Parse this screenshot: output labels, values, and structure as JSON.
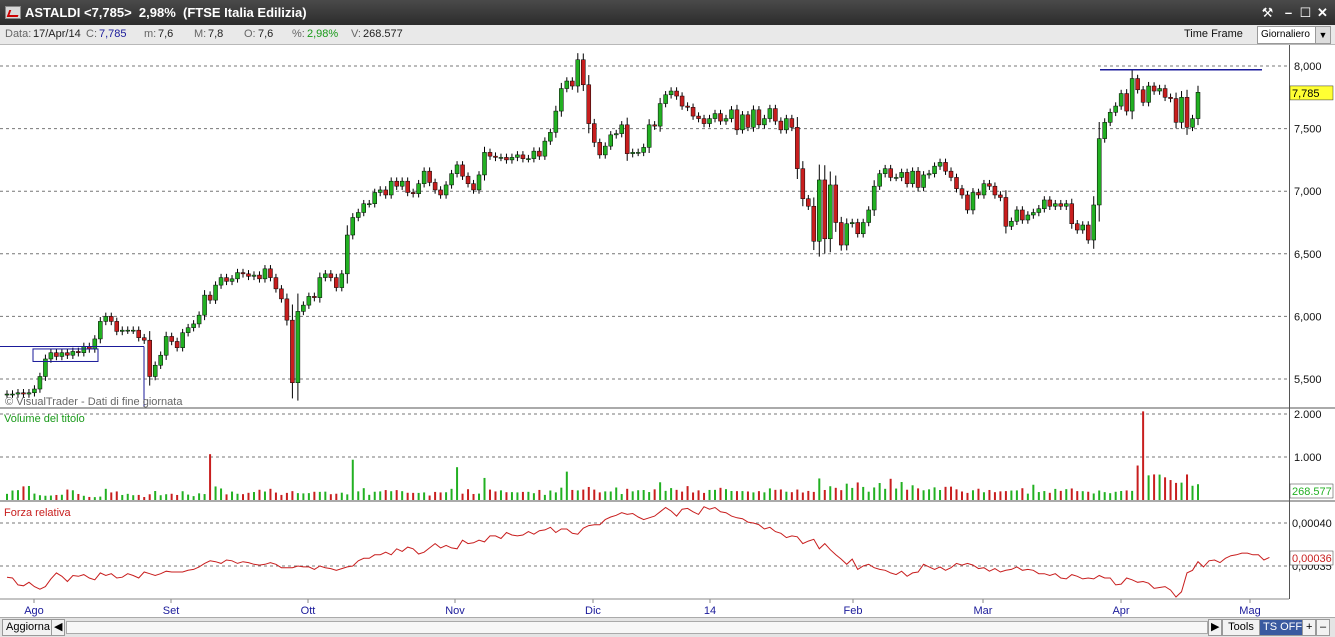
{
  "window": {
    "title": "ASTALDI <7,785>  2,98%  (FTSE Italia Edilizia)"
  },
  "info": {
    "data_label": "Data:",
    "data_value": "17/Apr/14",
    "c_label": "C:",
    "c_value": "7,785",
    "m_label": "m:",
    "m_value": "7,6",
    "M_label": "M:",
    "M_value": "7,8",
    "O_label": "O:",
    "O_value": "7,6",
    "pct_label": "%:",
    "pct_value": "2,98%",
    "v_label": "V:",
    "v_value": "268.577",
    "time_frame_label": "Time Frame",
    "time_frame_value": "Giornaliero"
  },
  "bottom": {
    "refresh": "Aggiorna",
    "tools": "Tools",
    "ts": "TS OFF"
  },
  "colors": {
    "up": "#22b022",
    "down": "#c81e1e",
    "rs": "#c81e1e",
    "axis_label": "#1a1a9a"
  },
  "chart": {
    "watermark": "© VisualTrader - Dati di fine giornata",
    "volume_title": "Volume del titolo",
    "rs_title": "Forza relativa"
  },
  "chart_data": {
    "type": "candlestick",
    "x_labels": [
      "Ago",
      "Set",
      "Ott",
      "Nov",
      "Dic",
      "14",
      "Feb",
      "Mar",
      "Apr",
      "Mag"
    ],
    "price_ticks": [
      "8,000",
      "7,500",
      "7,000",
      "6,500",
      "6,000",
      "5,500"
    ],
    "volume_ticks": [
      "2.000",
      "1.000"
    ],
    "rs_ticks": [
      "0,00040",
      "0,00035"
    ],
    "last_price_label": "7,785",
    "last_volume_label": "268.577",
    "last_rs_label": "0,00036",
    "price_ylim": [
      5.25,
      8.1
    ],
    "volume_ylim": [
      0,
      2000
    ],
    "rs_ylim": [
      0.00031,
      0.00042
    ],
    "resistance_level": 7.97,
    "closes": [
      5.38,
      5.38,
      5.39,
      5.38,
      5.39,
      5.42,
      5.52,
      5.66,
      5.71,
      5.68,
      5.71,
      5.69,
      5.72,
      5.71,
      5.76,
      5.74,
      5.82,
      5.96,
      6,
      5.96,
      5.88,
      5.89,
      5.89,
      5.89,
      5.83,
      5.81,
      5.52,
      5.61,
      5.69,
      5.84,
      5.8,
      5.75,
      5.87,
      5.91,
      5.94,
      6.01,
      6.17,
      6.13,
      6.25,
      6.31,
      6.28,
      6.3,
      6.35,
      6.34,
      6.32,
      6.33,
      6.3,
      6.38,
      6.31,
      6.22,
      6.14,
      5.97,
      5.47,
      6.04,
      6.09,
      6.16,
      6.15,
      6.31,
      6.34,
      6.31,
      6.23,
      6.34,
      6.65,
      6.79,
      6.83,
      6.9,
      6.9,
      6.99,
      7.01,
      6.97,
      7.08,
      7.04,
      7.08,
      6.99,
      6.98,
      7.06,
      7.16,
      7.07,
      7.01,
      6.97,
      7.05,
      7.14,
      7.21,
      7.12,
      7.06,
      7.01,
      7.13,
      7.31,
      7.28,
      7.27,
      7.27,
      7.25,
      7.27,
      7.29,
      7.26,
      7.26,
      7.32,
      7.28,
      7.4,
      7.47,
      7.64,
      7.82,
      7.88,
      7.84,
      8.05,
      7.85,
      7.54,
      7.39,
      7.29,
      7.36,
      7.45,
      7.46,
      7.53,
      7.3,
      7.31,
      7.31,
      7.35,
      7.53,
      7.52,
      7.7,
      7.77,
      7.8,
      7.76,
      7.68,
      7.67,
      7.6,
      7.58,
      7.54,
      7.58,
      7.62,
      7.56,
      7.58,
      7.65,
      7.49,
      7.61,
      7.51,
      7.65,
      7.53,
      7.58,
      7.66,
      7.56,
      7.49,
      7.58,
      7.51,
      7.18,
      6.94,
      6.88,
      6.6,
      7.09,
      6.62,
      7.05,
      6.75,
      6.57,
      6.74,
      6.75,
      6.66,
      6.75,
      6.85,
      7.04,
      7.14,
      7.18,
      7.11,
      7.11,
      7.15,
      7.06,
      7.16,
      7.03,
      7.13,
      7.14,
      7.2,
      7.23,
      7.16,
      7.11,
      7.02,
      6.97,
      6.85,
      6.99,
      6.97,
      7.06,
      7.04,
      6.97,
      6.95,
      6.72,
      6.76,
      6.85,
      6.77,
      6.81,
      6.83,
      6.86,
      6.93,
      6.88,
      6.9,
      6.88,
      6.9,
      6.74,
      6.69,
      6.73,
      6.61,
      6.89,
      7.42,
      7.55,
      7.63,
      7.68,
      7.78,
      7.64,
      7.9,
      7.81,
      7.71,
      7.84,
      7.8,
      7.82,
      7.75,
      7.74,
      7.55,
      7.75,
      7.51,
      7.58,
      7.79
    ],
    "volumes": [
      143,
      221,
      229,
      317,
      326,
      149,
      111,
      99,
      104,
      117,
      122,
      243,
      226,
      140,
      98,
      71,
      67,
      79,
      260,
      176,
      199,
      117,
      143,
      112,
      118,
      69,
      133,
      209,
      111,
      134,
      145,
      117,
      204,
      126,
      90,
      155,
      138,
      1066,
      315,
      268,
      131,
      196,
      145,
      136,
      167,
      185,
      238,
      197,
      260,
      173,
      118,
      165,
      206,
      160,
      154,
      160,
      191,
      189,
      194,
      135,
      146,
      170,
      131,
      937,
      201,
      275,
      120,
      192,
      200,
      231,
      204,
      230,
      205,
      168,
      166,
      165,
      176,
      104,
      188,
      176,
      180,
      260,
      763,
      147,
      251,
      140,
      149,
      513,
      242,
      199,
      224,
      181,
      183,
      177,
      188,
      190,
      158,
      234,
      119,
      221,
      177,
      287,
      660,
      234,
      223,
      242,
      303,
      242,
      177,
      200,
      198,
      291,
      139,
      260,
      201,
      227,
      232,
      185,
      248,
      412,
      213,
      277,
      236,
      195,
      323,
      175,
      224,
      165,
      234,
      236,
      283,
      252,
      209,
      206,
      207,
      198,
      177,
      206,
      178,
      270,
      236,
      245,
      193,
      182,
      243,
      174,
      211,
      188,
      501,
      233,
      320,
      283,
      229,
      380,
      281,
      408,
      304,
      193,
      292,
      395,
      260,
      493,
      266,
      418,
      239,
      342,
      270,
      226,
      248,
      294,
      232,
      306,
      311,
      248,
      198,
      165,
      226,
      262,
      180,
      233,
      182,
      201,
      207,
      220,
      223,
      274,
      148,
      355,
      185,
      208,
      167,
      258,
      212,
      252,
      268,
      207,
      205,
      192,
      152,
      221,
      183,
      159,
      191,
      209,
      222,
      212,
      802,
      2061,
      573,
      595,
      591,
      527,
      464,
      398,
      404,
      594,
      331,
      367,
      252,
      536,
      421,
      299,
      269
    ],
    "relative_strength": [
      0.000337,
      0.000336,
      0.000328,
      0.000327,
      0.000331,
      0.000326,
      0.000323,
      0.000326,
      0.000335,
      0.000342,
      0.000338,
      0.000332,
      0.000339,
      0.000338,
      0.00034,
      0.000336,
      0.000334,
      0.000342,
      0.000339,
      0.000341,
      0.000336,
      0.000337,
      0.000341,
      0.000339,
      0.000336,
      0.000343,
      0.000341,
      0.000339,
      0.000341,
      0.000344,
      0.000343,
      0.000343,
      0.000343,
      0.000345,
      0.000346,
      0.000349,
      0.000353,
      0.000356,
      0.000355,
      0.000353,
      0.000357,
      0.000356,
      0.000353,
      0.000355,
      0.000354,
      0.000352,
      0.000351,
      0.000352,
      0.000354,
      0.000352,
      0.000348,
      0.000348,
      0.000348,
      0.00035,
      0.000349,
      0.000349,
      0.000346,
      0.00035,
      0.000348,
      0.000347,
      0.000345,
      0.000347,
      0.000349,
      0.00035,
      0.000356,
      0.000359,
      0.000359,
      0.000363,
      0.000363,
      0.000366,
      0.000363,
      0.00037,
      0.000367,
      0.000372,
      0.00037,
      0.000364,
      0.000366,
      0.000371,
      0.000376,
      0.000371,
      0.000374,
      0.000371,
      0.00037,
      0.00038,
      0.000376,
      0.000377,
      0.00038,
      0.000378,
      0.000385,
      0.000385,
      0.000382,
      0.000389,
      0.000386,
      0.000385,
      0.000386,
      0.00039,
      0.000387,
      0.000391,
      0.000392,
      0.000395,
      0.000389,
      0.000393,
      0.000393,
      0.000388,
      0.000387,
      0.000394,
      0.000397,
      0.000398,
      0.000398,
      0.000404,
      0.000407,
      0.000409,
      0.000412,
      0.00041,
      0.000411,
      0.000407,
      0.000404,
      0.000406,
      0.000408,
      0.000413,
      0.000418,
      0.000414,
      0.000408,
      0.000416,
      0.000417,
      0.000413,
      0.00041,
      0.000419,
      0.000416,
      0.000418,
      0.000413,
      0.000412,
      0.000408,
      0.000406,
      0.000405,
      0.000401,
      0.0004,
      0.000398,
      0.000393,
      0.000395,
      0.00039,
      0.000388,
      0.000383,
      0.000385,
      0.000384,
      0.000376,
      0.000379,
      0.000381,
      0.00037,
      0.000376,
      0.000369,
      0.000363,
      0.000358,
      0.000352,
      0.000358,
      0.000346,
      0.00035,
      0.000352,
      0.000348,
      0.000346,
      0.000345,
      0.000342,
      0.00034,
      0.000344,
      0.000338,
      0.000342,
      0.000343,
      0.000352,
      0.000349,
      0.000346,
      0.000349,
      0.000345,
      0.000348,
      0.000353,
      0.000351,
      0.000353,
      0.000351,
      0.000347,
      0.000348,
      0.000344,
      0.000347,
      0.000343,
      0.000345,
      0.000346,
      0.000349,
      0.000345,
      0.000346,
      0.000345,
      0.000341,
      0.000341,
      0.000339,
      0.000341,
      0.000336,
      0.000335,
      0.00034,
      0.000338,
      0.000335,
      0.000336,
      0.000335,
      0.000339,
      0.000336,
      0.000336,
      0.000328,
      0.000329,
      0.000336,
      0.000334,
      0.000331,
      0.000332,
      0.00033,
      0.000324,
      0.000325,
      0.000326,
      0.000322,
      0.000314,
      0.00032,
      0.000342,
      0.000345,
      0.000355,
      0.000349,
      0.000356,
      0.000357,
      0.000354,
      0.000359,
      0.000362,
      0.000363,
      0.000365,
      0.000365,
      0.000363,
      0.000363,
      0.000357,
      0.00036
    ]
  }
}
